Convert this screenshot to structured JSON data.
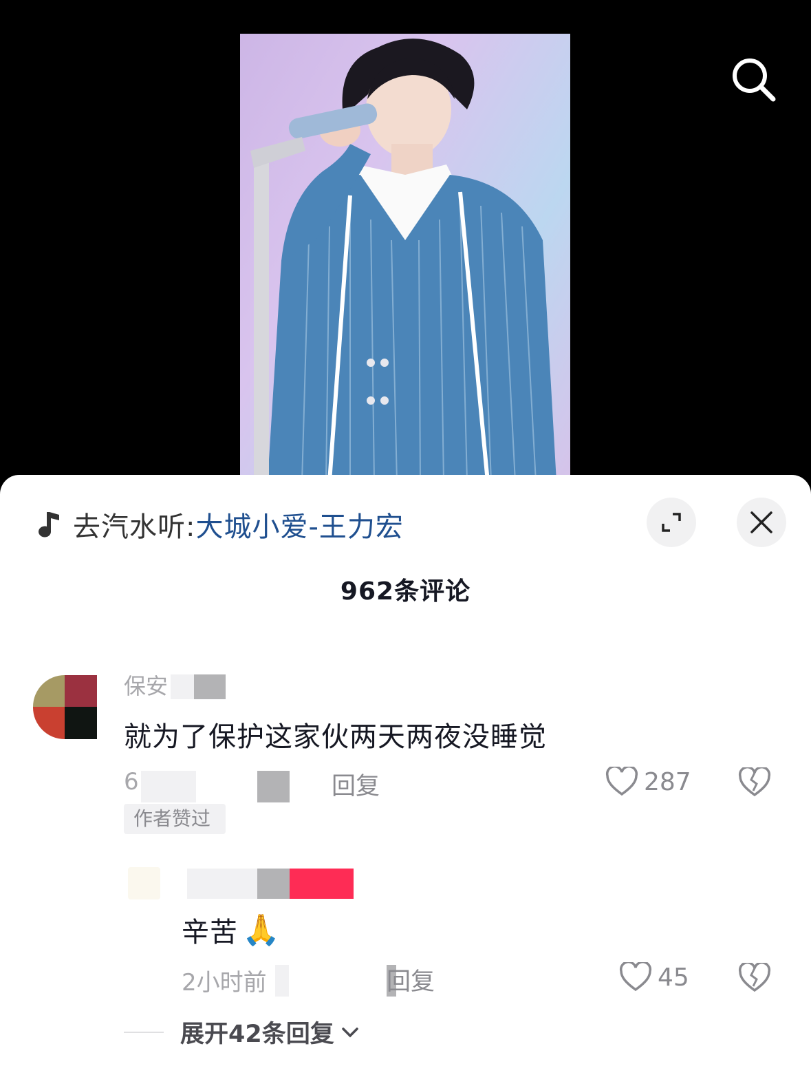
{
  "music": {
    "prefix": "去汽水听:",
    "song": "大城小爱-王力宏"
  },
  "comments_header": {
    "count_label": "962条评论"
  },
  "comments": [
    {
      "username": "保安",
      "text": "就为了保护这家伙两天两夜没睡觉",
      "time": "6",
      "reply_label": "回复",
      "likes": "287",
      "badge": "作者赞过"
    },
    {
      "text": "辛苦",
      "emoji": "🙏",
      "time": "2小时前",
      "reply_label": "回复",
      "likes": "45"
    }
  ],
  "expand_replies_label": "展开42条回复",
  "colors": {
    "link": "#1f4f8f",
    "text": "#161823",
    "muted": "#a7a7ab",
    "sheet": "#ffffff",
    "video_bg": "#000000",
    "redact_red": "#fe2c55"
  },
  "icons": [
    "search-icon",
    "music-note-icon",
    "expand-icon",
    "close-icon",
    "heart-icon",
    "broken-heart-icon",
    "chevron-down-icon"
  ]
}
